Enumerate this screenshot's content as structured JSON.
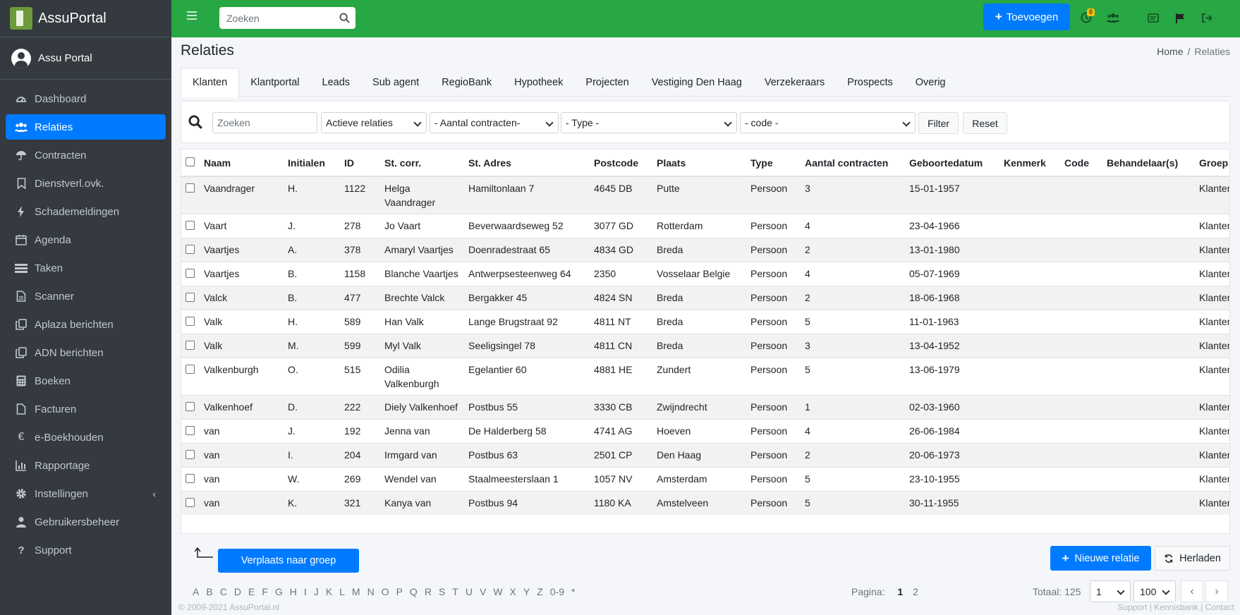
{
  "brand": {
    "name": "AssuPortal"
  },
  "user": {
    "name": "Assu Portal"
  },
  "sidebar": {
    "items": [
      {
        "label": "Dashboard",
        "icon": "dashboard-icon"
      },
      {
        "label": "Relaties",
        "icon": "users-icon",
        "active": true
      },
      {
        "label": "Contracten",
        "icon": "umbrella-icon"
      },
      {
        "label": "Dienstverl.ovk.",
        "icon": "bookmark-icon"
      },
      {
        "label": "Schademeldingen",
        "icon": "bolt-icon"
      },
      {
        "label": "Agenda",
        "icon": "calendar-icon"
      },
      {
        "label": "Taken",
        "icon": "tasks-icon"
      },
      {
        "label": "Scanner",
        "icon": "file-icon"
      },
      {
        "label": "Aplaza berichten",
        "icon": "copy-icon"
      },
      {
        "label": "ADN berichten",
        "icon": "copy-icon"
      },
      {
        "label": "Boeken",
        "icon": "calculator-icon"
      },
      {
        "label": "Facturen",
        "icon": "invoice-icon"
      },
      {
        "label": "e-Boekhouden",
        "icon": "euro-icon"
      },
      {
        "label": "Rapportage",
        "icon": "chart-icon"
      },
      {
        "label": "Instellingen",
        "icon": "gear-icon"
      },
      {
        "label": "Gebruikersbeheer",
        "icon": "user-icon"
      },
      {
        "label": "Support",
        "icon": "question-icon"
      }
    ]
  },
  "header": {
    "search_placeholder": "Zoeken",
    "add_button": "Toevoegen",
    "notification_count": "0"
  },
  "page": {
    "title": "Relaties",
    "breadcrumb": {
      "home": "Home",
      "separator": "/",
      "current": "Relaties"
    }
  },
  "tabs": [
    "Klanten",
    "Klantportal",
    "Leads",
    "Sub agent",
    "RegioBank",
    "Hypotheek",
    "Projecten",
    "Vestiging Den Haag",
    "Verzekeraars",
    "Prospects",
    "Overig"
  ],
  "filters": {
    "search_placeholder": "Zoeken",
    "status": "Actieve relaties",
    "contracts": "- Aantal contracten-",
    "type": "- Type -",
    "code": "- code -",
    "filter_button": "Filter",
    "reset_button": "Reset"
  },
  "table": {
    "columns": [
      "Naam",
      "Initialen",
      "ID",
      "St. corr.",
      "St. Adres",
      "Postcode",
      "Plaats",
      "Type",
      "Aantal contracten",
      "Geboortedatum",
      "Kenmerk",
      "Code",
      "Behandelaar(s)",
      "Groep"
    ],
    "rows": [
      [
        "Vaandrager",
        "H.",
        "1122",
        "Helga Vaandrager",
        "Hamiltonlaan 7",
        "4645 DB",
        "Putte",
        "Persoon",
        "3",
        "15-01-1957",
        "",
        "",
        "",
        "Klanten"
      ],
      [
        "Vaart",
        "J.",
        "278",
        "Jo Vaart",
        "Beverwaardseweg 52",
        "3077 GD",
        "Rotterdam",
        "Persoon",
        "4",
        "23-04-1966",
        "",
        "",
        "",
        "Klanten"
      ],
      [
        "Vaartjes",
        "A.",
        "378",
        "Amaryl Vaartjes",
        "Doenradestraat 65",
        "4834 GD",
        "Breda",
        "Persoon",
        "2",
        "13-01-1980",
        "",
        "",
        "",
        "Klanten"
      ],
      [
        "Vaartjes",
        "B.",
        "1158",
        "Blanche Vaartjes",
        "Antwerpsesteenweg 64",
        "2350",
        "Vosselaar Belgie",
        "Persoon",
        "4",
        "05-07-1969",
        "",
        "",
        "",
        "Klanten"
      ],
      [
        "Valck",
        "B.",
        "477",
        "Brechte Valck",
        "Bergakker 45",
        "4824 SN",
        "Breda",
        "Persoon",
        "2",
        "18-06-1968",
        "",
        "",
        "",
        "Klanten"
      ],
      [
        "Valk",
        "H.",
        "589",
        "Han Valk",
        "Lange Brugstraat 92",
        "4811 NT",
        "Breda",
        "Persoon",
        "5",
        "11-01-1963",
        "",
        "",
        "",
        "Klanten"
      ],
      [
        "Valk",
        "M.",
        "599",
        "Myl Valk",
        "Seeligsingel 78",
        "4811 CN",
        "Breda",
        "Persoon",
        "3",
        "13-04-1952",
        "",
        "",
        "",
        "Klanten"
      ],
      [
        "Valkenburgh",
        "O.",
        "515",
        "Odilia Valkenburgh",
        "Egelantier 60",
        "4881 HE",
        "Zundert",
        "Persoon",
        "5",
        "13-06-1979",
        "",
        "",
        "",
        "Klanten"
      ],
      [
        "Valkenhoef",
        "D.",
        "222",
        "Diely Valkenhoef",
        "Postbus 55",
        "3330 CB",
        "Zwijndrecht",
        "Persoon",
        "1",
        "02-03-1960",
        "",
        "",
        "",
        "Klanten"
      ],
      [
        "van",
        "J.",
        "192",
        "Jenna van",
        "De Halderberg 58",
        "4741 AG",
        "Hoeven",
        "Persoon",
        "4",
        "26-06-1984",
        "",
        "",
        "",
        "Klanten"
      ],
      [
        "van",
        "I.",
        "204",
        "Irmgard van",
        "Postbus 63",
        "2501 CP",
        "Den Haag",
        "Persoon",
        "2",
        "20-06-1973",
        "",
        "",
        "",
        "Klanten"
      ],
      [
        "van",
        "W.",
        "269",
        "Wendel van",
        "Staalmeesterslaan 1",
        "1057 NV",
        "Amsterdam",
        "Persoon",
        "5",
        "23-10-1955",
        "",
        "",
        "",
        "Klanten"
      ],
      [
        "van",
        "K.",
        "321",
        "Kanya van",
        "Postbus 94",
        "1180 KA",
        "Amstelveen",
        "Persoon",
        "5",
        "30-11-1955",
        "",
        "",
        "",
        "Klanten"
      ]
    ]
  },
  "actions": {
    "move_group": "Verplaats naar groep",
    "new_relation": "Nieuwe relatie",
    "reload": "Herladen"
  },
  "alphabet": [
    "A",
    "B",
    "C",
    "D",
    "E",
    "F",
    "G",
    "H",
    "I",
    "J",
    "K",
    "L",
    "M",
    "N",
    "O",
    "P",
    "Q",
    "R",
    "S",
    "T",
    "U",
    "V",
    "W",
    "X",
    "Y",
    "Z",
    "0-9",
    "*"
  ],
  "pagination": {
    "label": "Pagina:",
    "pages": [
      "1",
      "2"
    ],
    "current": "1",
    "total_label": "Totaal: 125",
    "page_select": "1",
    "per_page": "100",
    "prev": "‹",
    "next": "›"
  },
  "footer": {
    "copyright": "© 2009-2021 AssuPortal.nl",
    "links": "Support | Kennisbank | Contact"
  },
  "colors": {
    "topbar": "#28a745",
    "primary": "#007bff",
    "sidebar": "#343a40"
  }
}
